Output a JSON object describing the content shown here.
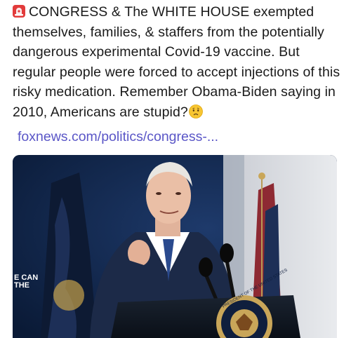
{
  "post": {
    "icon_start": "police-car-light-icon",
    "body_text": "CONGRESS & The WHITE HOUSE exempted themselves, families, & staffers from the potentially dangerous experimental Covid-19 vaccine. But regular people were forced to accept injections of this risky medication. Remember Obama-Biden saying in 2010, Americans are stupid?",
    "icon_end": "worried-face-icon"
  },
  "link": {
    "display_url": "foxnews.com/politics/congress-..."
  },
  "preview": {
    "image_alt": "photo of a man in a dark suit speaking at a podium with microphones",
    "podium_seal_text": "PRESIDENT OF THE UNITED STATES",
    "backdrop_text": "E CAN THE",
    "colors": {
      "link": "#5a56c7",
      "backdrop": "#0f2448",
      "suit": "#1c2a48"
    }
  }
}
